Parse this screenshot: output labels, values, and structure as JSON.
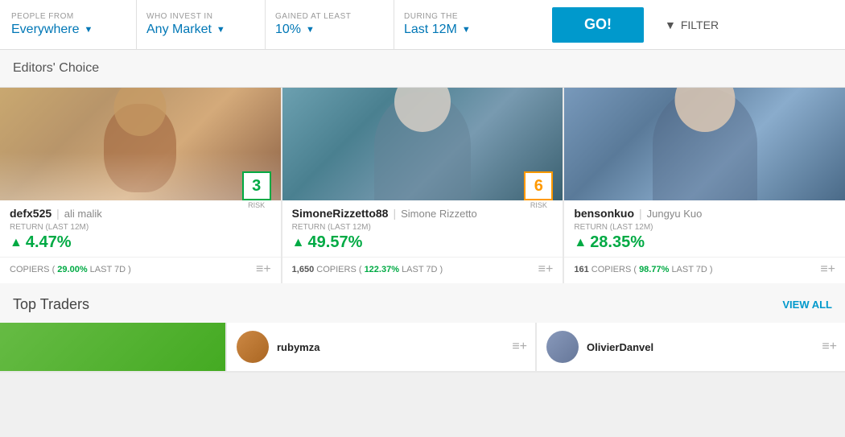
{
  "topbar": {
    "people_from_label": "PEOPLE FROM",
    "people_from_value": "Everywhere",
    "who_invest_label": "WHO INVEST IN",
    "who_invest_value": "Any Market",
    "gained_label": "GAINED AT LEAST",
    "gained_value": "10%",
    "during_label": "DURING THE",
    "during_value": "Last 12M",
    "go_button": "GO!",
    "filter_button": "FILTER"
  },
  "editors_choice": {
    "title": "Editors' Choice",
    "cards": [
      {
        "username": "defx525",
        "realname": "ali malik",
        "return_value": "4.47%",
        "return_label": "RETURN (LAST 12M)",
        "risk": "3",
        "risk_type": "green",
        "copiers_count": "",
        "copiers_label": "COPIERS (",
        "copiers_change": "29.00%",
        "copiers_suffix": "LAST 7D )"
      },
      {
        "username": "SimoneRizzetto88",
        "realname": "Simone Rizzetto",
        "return_value": "49.57%",
        "return_label": "RETURN (LAST 12M)",
        "risk": "6",
        "risk_type": "orange",
        "copiers_count": "1,650",
        "copiers_label": "COPIERS (",
        "copiers_change": "122.37%",
        "copiers_suffix": "LAST 7D )"
      },
      {
        "username": "bensonkuo",
        "realname": "Jungyu Kuo",
        "return_value": "28.35%",
        "return_label": "RETURN (LAST 12M)",
        "risk": "",
        "risk_type": "none",
        "copiers_count": "161",
        "copiers_label": "COPIERS (",
        "copiers_change": "98.77%",
        "copiers_suffix": "LAST 7D )"
      }
    ]
  },
  "top_traders": {
    "title": "Top Traders",
    "view_all": "VIEW ALL",
    "cards": [
      {
        "username": "",
        "type": "green_bg"
      },
      {
        "username": "rubymza",
        "type": "avatar"
      },
      {
        "username": "OlivierDanvel",
        "type": "avatar"
      }
    ]
  }
}
